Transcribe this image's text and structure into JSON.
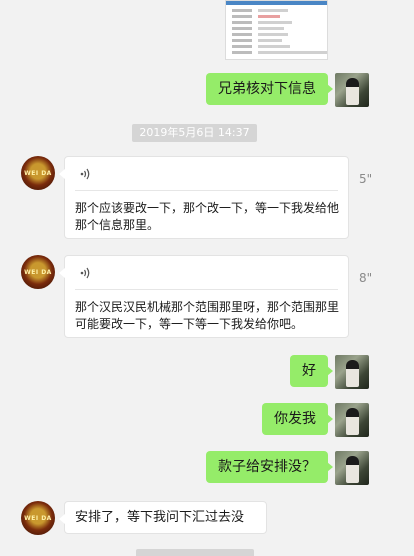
{
  "messages": [
    {
      "side": "right",
      "type": "image"
    },
    {
      "side": "right",
      "type": "text",
      "text": "兄弟核对下信息"
    },
    {
      "side": "center",
      "type": "time",
      "text": "2019年5月6日 14:37"
    },
    {
      "side": "left",
      "type": "voice",
      "duration": "5\"",
      "transcript": "那个应该要改一下，那个改一下，等一下我发给他那个信息那里。"
    },
    {
      "side": "left",
      "type": "voice",
      "duration": "8\"",
      "transcript": "那个汉民汉民机械那个范围那里呀，那个范围那里可能要改一下，等一下等一下我发给你吧。"
    },
    {
      "side": "right",
      "type": "text",
      "text": "好"
    },
    {
      "side": "right",
      "type": "text",
      "text": "你发我"
    },
    {
      "side": "right",
      "type": "text",
      "text": "款子给安排没？"
    },
    {
      "side": "left",
      "type": "text",
      "text": "安排了，等下我问下汇过去没"
    }
  ],
  "avatar_left": {
    "logo_text": "WEI DA",
    "icon": "company-logo-avatar"
  },
  "avatar_right": {
    "icon": "user-photo-avatar"
  },
  "colors": {
    "background": "#f2f2f2",
    "sent_bubble": "#95ec69",
    "received_bubble": "#ffffff",
    "timestamp_bg": "#d5d5d5"
  }
}
